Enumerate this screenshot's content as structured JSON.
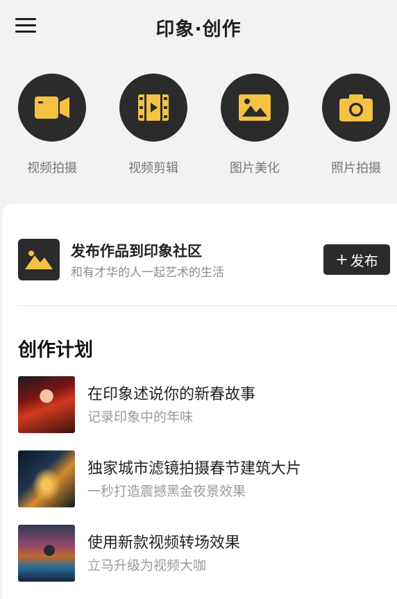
{
  "header": {
    "title": "印象·创作",
    "menu_icon": "hamburger-menu-icon"
  },
  "tools": [
    {
      "label": "视频拍摄",
      "icon": "video-camera-icon"
    },
    {
      "label": "视频剪辑",
      "icon": "film-edit-icon"
    },
    {
      "label": "图片美化",
      "icon": "image-icon"
    },
    {
      "label": "照片拍摄",
      "icon": "photo-camera-icon"
    }
  ],
  "publish": {
    "title": "发布作品到印象社区",
    "subtitle": "和有才华的人一起艺术的生活",
    "button_plus": "+",
    "button_label": "发布",
    "icon": "image-icon"
  },
  "plan": {
    "title": "创作计划",
    "items": [
      {
        "title": "在印象述说你的新春故事",
        "subtitle": "记录印象中的年味"
      },
      {
        "title": "独家城市滤镜拍摄春节建筑大片",
        "subtitle": "一秒打造震撼黑金夜景效果"
      },
      {
        "title": "使用新款视频转场效果",
        "subtitle": "立马升级为视频大咖"
      }
    ]
  },
  "colors": {
    "accent": "#f5c244",
    "dark": "#2b2b2b",
    "background": "#f2f2f2",
    "card": "#ffffff"
  }
}
